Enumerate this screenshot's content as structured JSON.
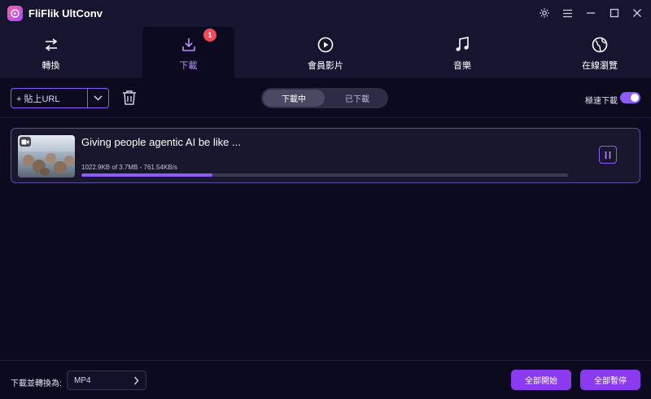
{
  "app": {
    "title": "FliFlik UltConv"
  },
  "window_controls": {
    "settings_icon": "gear-icon",
    "menu_icon": "menu-icon",
    "minimize_icon": "minimize-icon",
    "maximize_icon": "maximize-icon",
    "close_icon": "close-icon"
  },
  "nav": {
    "tabs": [
      {
        "label": "轉換",
        "icon": "swap-arrows-icon"
      },
      {
        "label": "下載",
        "icon": "download-icon",
        "badge": "1",
        "active": true
      },
      {
        "label": "會員影片",
        "icon": "play-circle-icon"
      },
      {
        "label": "音樂",
        "icon": "music-note-icon"
      },
      {
        "label": "在線瀏覽",
        "icon": "globe-icon"
      }
    ]
  },
  "toolbar": {
    "paste_label": "+ 貼上URL",
    "segments": [
      {
        "label": "下載中",
        "active": true
      },
      {
        "label": "已下載",
        "active": false
      }
    ],
    "turbo_label": "極速下載",
    "turbo_on": true
  },
  "downloads": [
    {
      "title": "Giving people agentic AI be like ...",
      "stats": "1022.9KB of 3.7MB -  761.54KB/s",
      "progress": 0.27
    }
  ],
  "footer": {
    "convert_label": "下載並轉換為:",
    "format": "MP4",
    "start_all": "全部開始",
    "pause_all": "全部暫停"
  },
  "colors": {
    "accent": "#8b5cf6",
    "button": "#8b3bef",
    "background": "#0b0a1f",
    "badge": "#f04a5a"
  }
}
